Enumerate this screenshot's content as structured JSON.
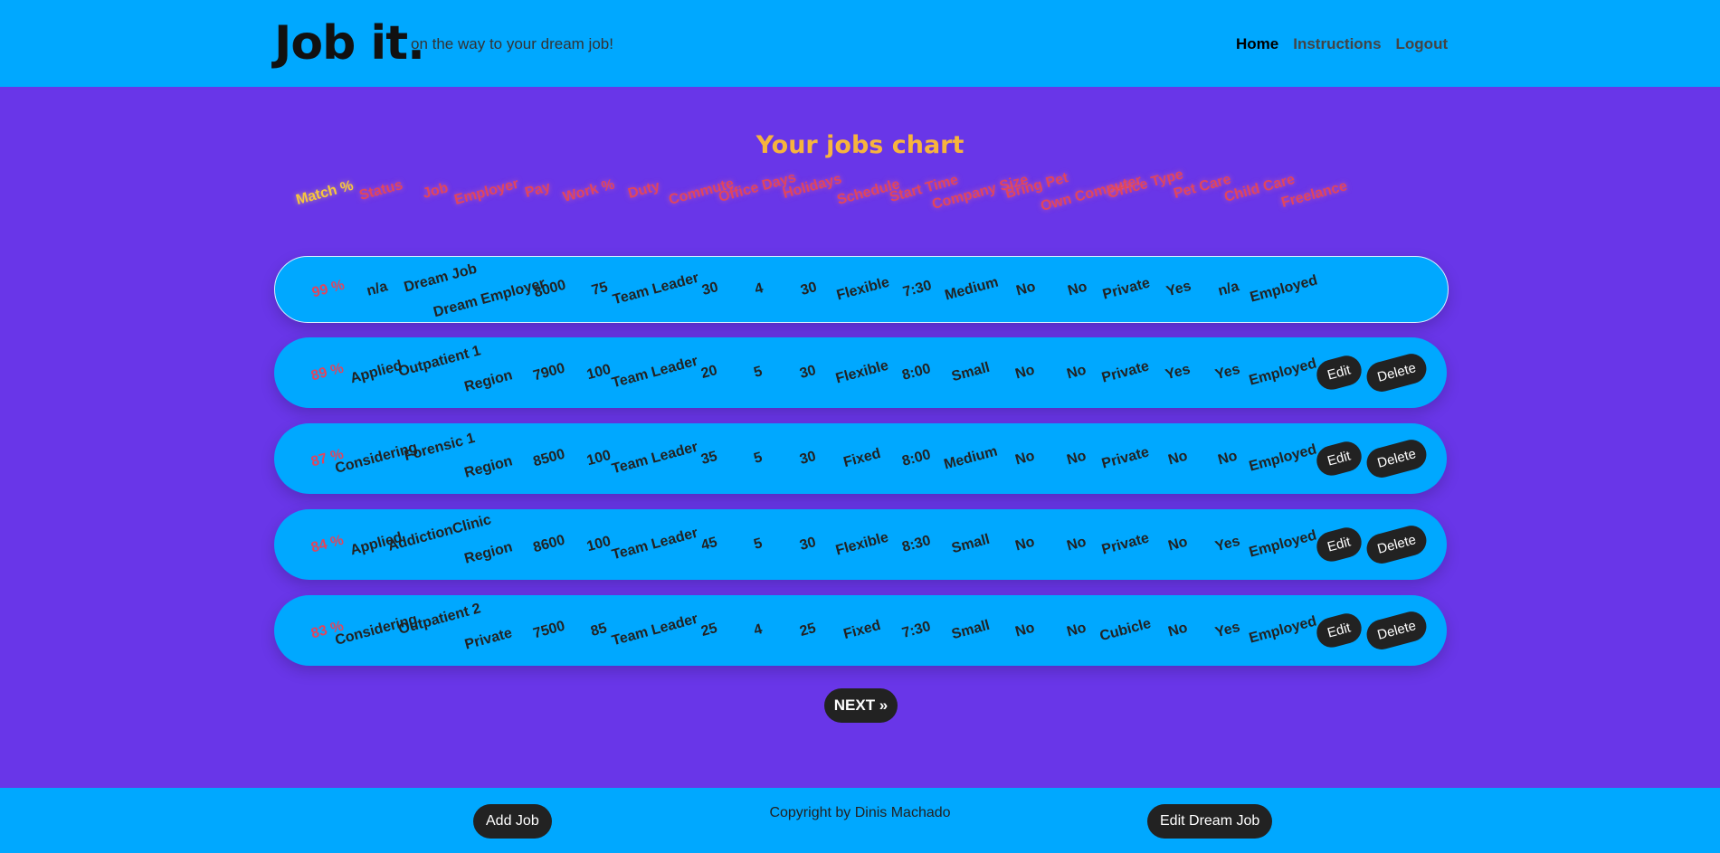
{
  "header": {
    "brand": "Job it.",
    "tagline": "on the way to your dream job!",
    "nav": [
      {
        "label": "Home",
        "active": true
      },
      {
        "label": "Instructions",
        "active": false
      },
      {
        "label": "Logout",
        "active": false
      }
    ]
  },
  "main": {
    "title": "Your jobs chart",
    "columns": [
      "Match %",
      "Status",
      "Job",
      "Employer",
      "Pay",
      "Work %",
      "Duty",
      "Commute",
      "Office Days",
      "Holidays",
      "Schedule",
      "Start Time",
      "Company Size",
      "Bring Pet",
      "Own Computer",
      "Office Type",
      "Pet Care",
      "Child Care",
      "Freelance"
    ],
    "rows": [
      {
        "match": "99 %",
        "status": "n/a",
        "job": "Dream Job",
        "employer": "Dream Employer",
        "pay": "8000",
        "work": "75",
        "duty": "Team Leader",
        "commute": "30",
        "office_days": "4",
        "holidays": "30",
        "schedule": "Flexible",
        "start_time": "7:30",
        "company_size": "Medium",
        "bring_pet": "No",
        "own_computer": "No",
        "office_type": "Private",
        "pet_care": "Yes",
        "child_care": "n/a",
        "freelance": "Employed",
        "dream": true
      },
      {
        "match": "89 %",
        "status": "Applied",
        "job": "Outpatient 1",
        "employer": "Region",
        "pay": "7900",
        "work": "100",
        "duty": "Team Leader",
        "commute": "20",
        "office_days": "5",
        "holidays": "30",
        "schedule": "Flexible",
        "start_time": "8:00",
        "company_size": "Small",
        "bring_pet": "No",
        "own_computer": "No",
        "office_type": "Private",
        "pet_care": "Yes",
        "child_care": "Yes",
        "freelance": "Employed"
      },
      {
        "match": "87 %",
        "status": "Considering",
        "job": "Forensic 1",
        "employer": "Region",
        "pay": "8500",
        "work": "100",
        "duty": "Team Leader",
        "commute": "35",
        "office_days": "5",
        "holidays": "30",
        "schedule": "Fixed",
        "start_time": "8:00",
        "company_size": "Medium",
        "bring_pet": "No",
        "own_computer": "No",
        "office_type": "Private",
        "pet_care": "No",
        "child_care": "No",
        "freelance": "Employed"
      },
      {
        "match": "84 %",
        "status": "Applied",
        "job": "AddictionClinic",
        "employer": "Region",
        "pay": "8600",
        "work": "100",
        "duty": "Team Leader",
        "commute": "45",
        "office_days": "5",
        "holidays": "30",
        "schedule": "Flexible",
        "start_time": "8:30",
        "company_size": "Small",
        "bring_pet": "No",
        "own_computer": "No",
        "office_type": "Private",
        "pet_care": "No",
        "child_care": "Yes",
        "freelance": "Employed"
      },
      {
        "match": "83 %",
        "status": "Considering",
        "job": "Outpatient 2",
        "employer": "Private",
        "pay": "7500",
        "work": "85",
        "duty": "Team Leader",
        "commute": "25",
        "office_days": "4",
        "holidays": "25",
        "schedule": "Fixed",
        "start_time": "7:30",
        "company_size": "Small",
        "bring_pet": "No",
        "own_computer": "No",
        "office_type": "Cubicle",
        "pet_care": "No",
        "child_care": "Yes",
        "freelance": "Employed"
      }
    ],
    "edit_label": "Edit",
    "delete_label": "Delete",
    "next_label": "NEXT »"
  },
  "footer": {
    "add_job_label": "Add Job",
    "copyright": "Copyright by Dinis Machado",
    "edit_dream_label": "Edit Dream Job"
  },
  "colors": {
    "page_bg": "#6936e8",
    "bar_bg": "#00a8ff",
    "title": "#f7b43d",
    "header_label": "#e0455d",
    "match_text": "#e0455d",
    "button_bg": "#222222"
  }
}
